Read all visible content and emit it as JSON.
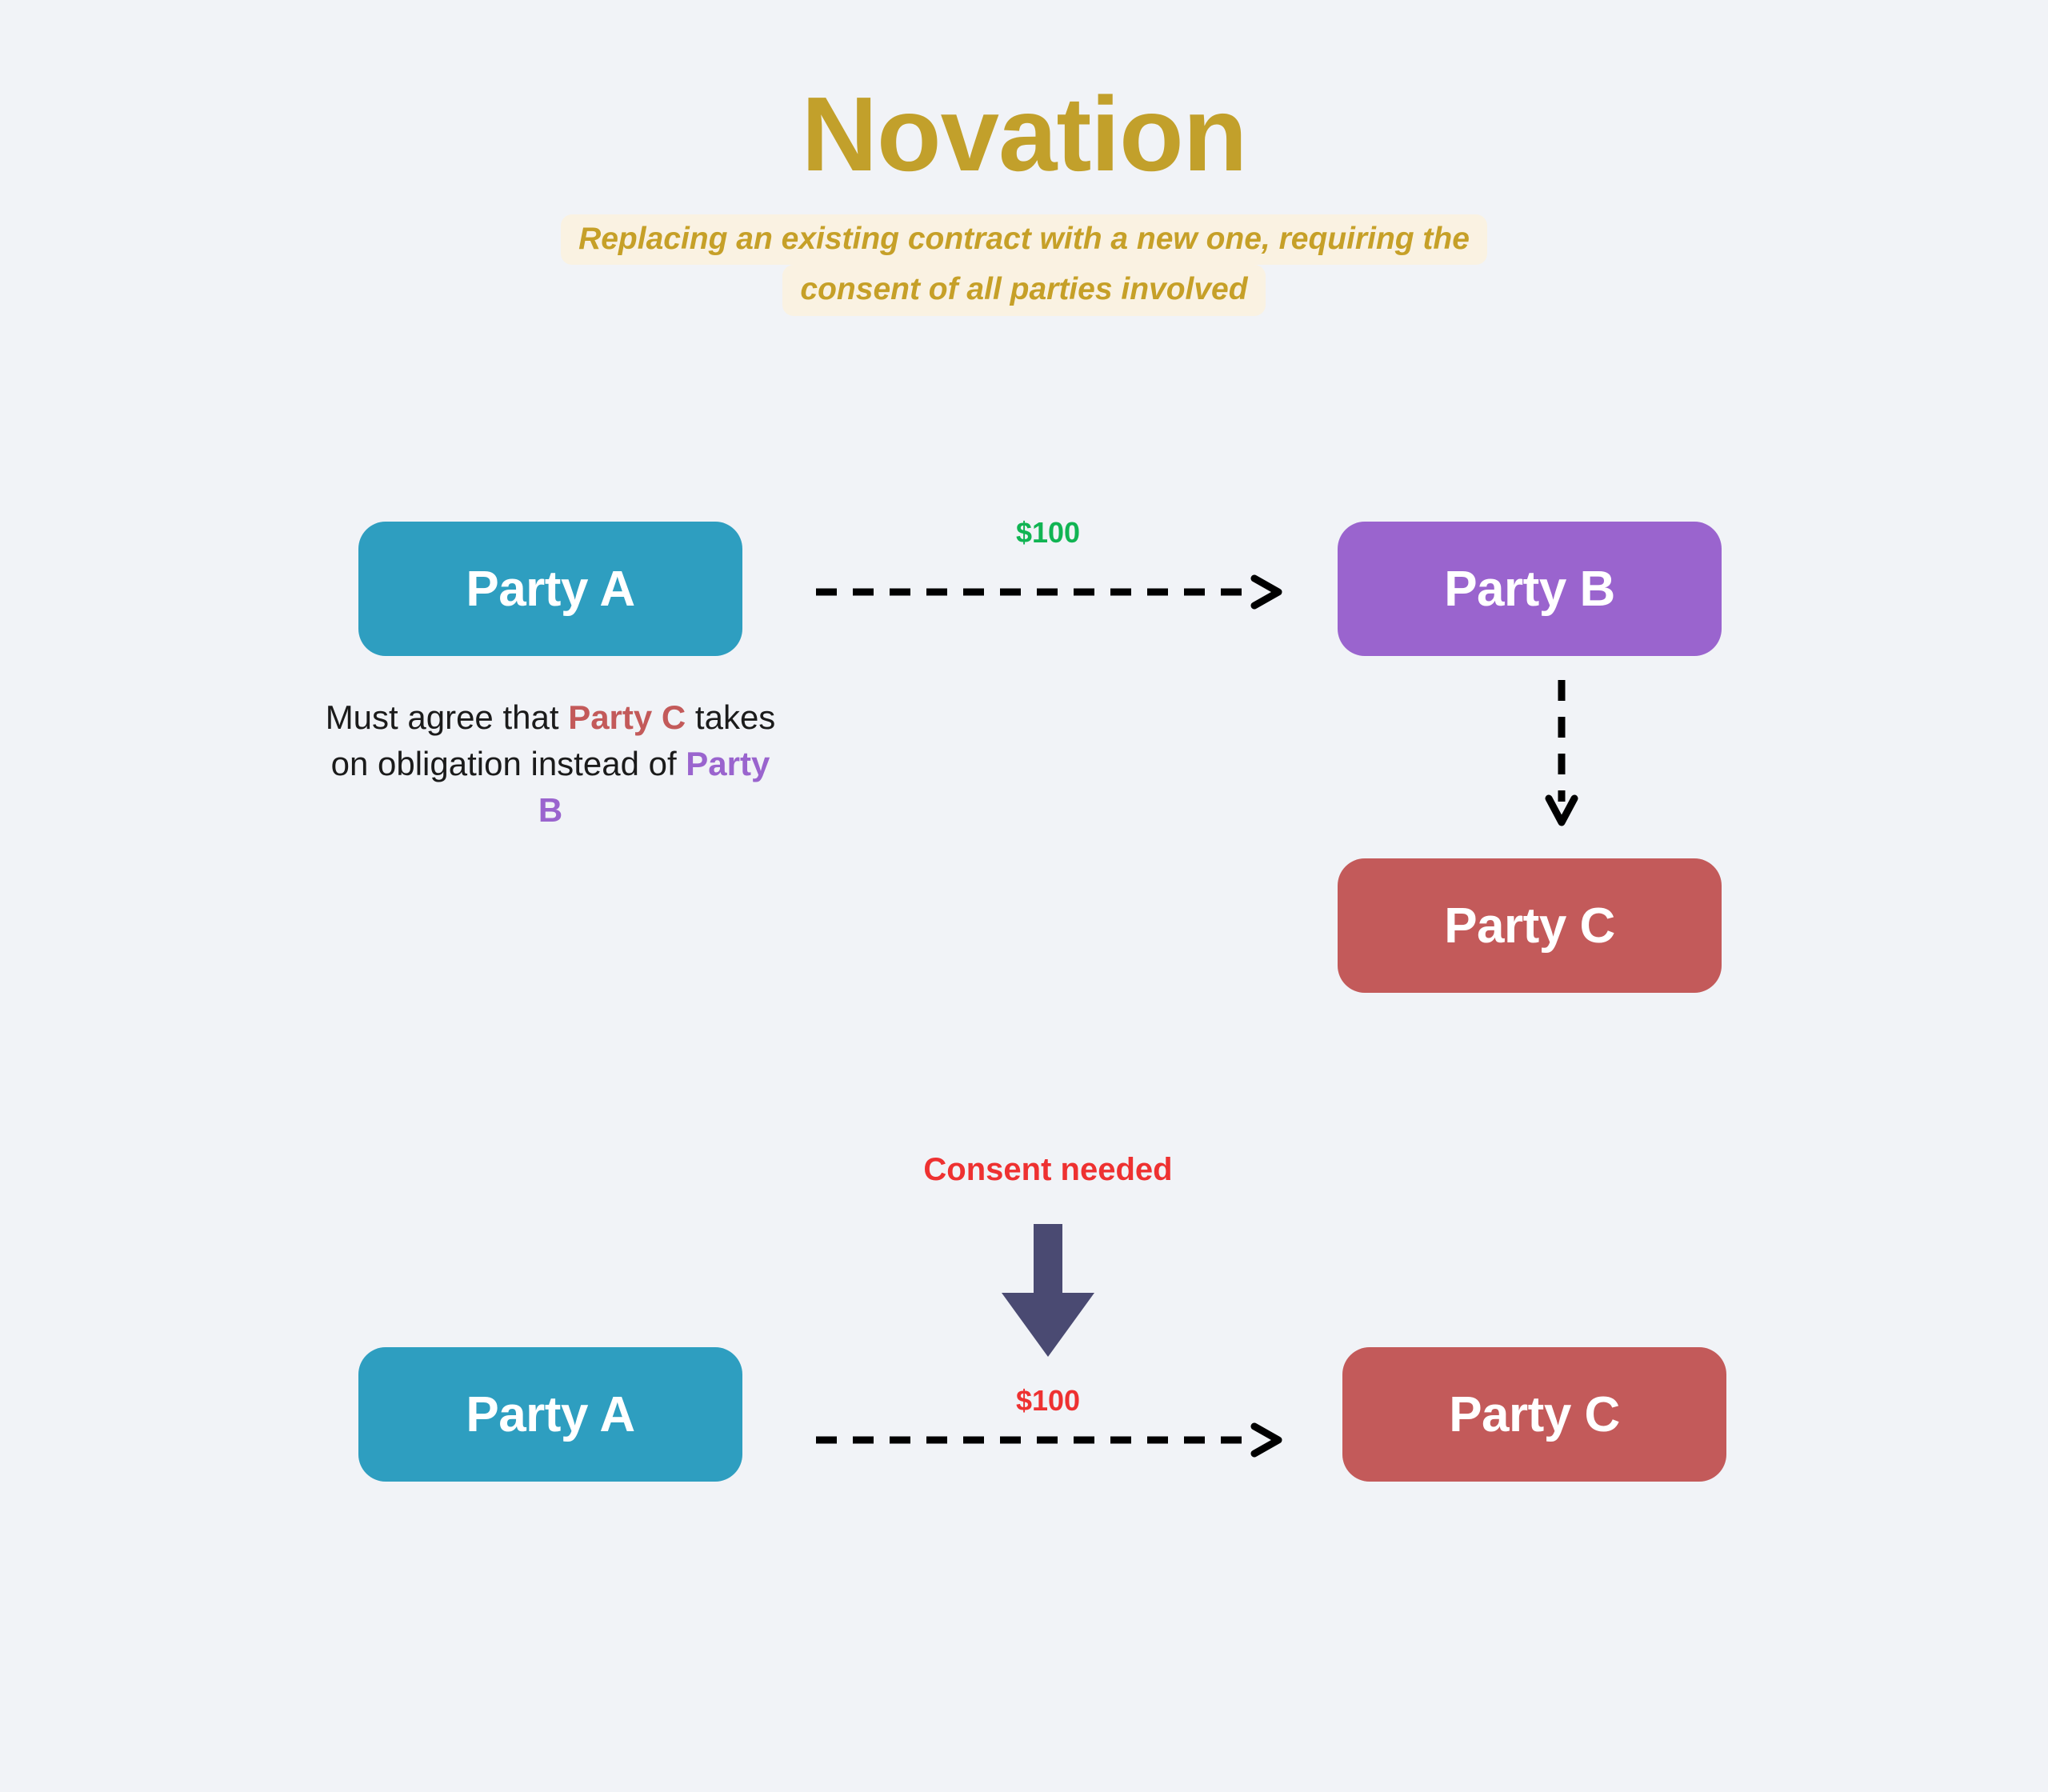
{
  "header": {
    "title": "Novation",
    "subtitle_lines": [
      "Replacing an existing contract with a new one, requiring the",
      "consent of all parties involved"
    ]
  },
  "colors": {
    "background": "#F1F3F7",
    "title": "#C2A02B",
    "subtitle_text": "#C6A028",
    "subtitle_highlight": "#FAF2E2",
    "party_a": "#2E9EC0",
    "party_b": "#9A64CE",
    "party_c": "#C35A5A",
    "amount_green": "#11B453",
    "amount_red": "#EE3131",
    "consent_text": "#EE3131",
    "consent_arrow": "#4A4A72",
    "dashed_arrow": "#000000"
  },
  "diagram_top": {
    "party_a_label": "Party A",
    "party_b_label": "Party B",
    "party_c_label": "Party C",
    "payment_label": "$100",
    "note": {
      "segment_1": "Must agree that ",
      "highlight_1": "Party C",
      "segment_2": " takes on obligation instead of ",
      "highlight_2": "Party B"
    }
  },
  "consent": {
    "label": "Consent needed",
    "arrow_icon": "down-arrow-icon"
  },
  "diagram_bottom": {
    "party_a_label": "Party A",
    "party_c_label": "Party C",
    "payment_label": "$100"
  },
  "icons": {
    "dashed_arrow_right": "dashed-arrow-right-icon",
    "dashed_arrow_down": "dashed-arrow-down-icon",
    "thick_arrow_down": "thick-arrow-down-icon"
  }
}
